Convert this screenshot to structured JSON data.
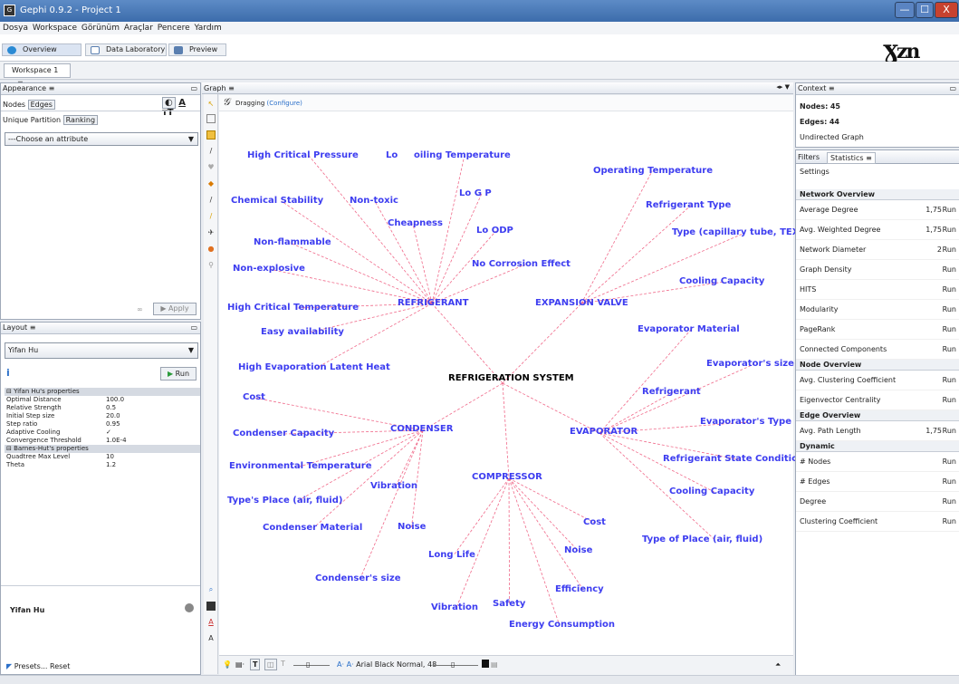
{
  "window": {
    "title": "Gephi 0.9.2 - Project 1",
    "minimize": "—",
    "maximize": "☐",
    "close": "X"
  },
  "menu": [
    "Dosya",
    "Workspace",
    "Görünüm",
    "Araçlar",
    "Pencere",
    "Yardım"
  ],
  "modes": {
    "overview": "Overview",
    "data_lab": "Data Laboratory",
    "preview": "Preview"
  },
  "workspace_tab": "Workspace 1",
  "tab_close": "≡",
  "appearance": {
    "title": "Appearance",
    "tabs": [
      "Nodes",
      "Edges"
    ],
    "subtabs": [
      "Unique",
      "Partition",
      "Ranking"
    ],
    "attribute_placeholder": "---Choose an attribute",
    "apply": "Apply",
    "icons": [
      "color-icon",
      "A",
      "тT"
    ]
  },
  "layout": {
    "title": "Layout",
    "algorithm": "Yifan Hu",
    "run": "Run",
    "footer_name": "Yifan Hu",
    "presets": "Presets...",
    "reset": "Reset",
    "props": [
      {
        "k": "Yifan Hu's properties",
        "v": "",
        "sec": true
      },
      {
        "k": "Optimal Distance",
        "v": "100.0"
      },
      {
        "k": "Relative Strength",
        "v": "0.5"
      },
      {
        "k": "Initial Step size",
        "v": "20.0"
      },
      {
        "k": "Step ratio",
        "v": "0.95"
      },
      {
        "k": "Adaptive Cooling",
        "v": "✓"
      },
      {
        "k": "Convergence Threshold",
        "v": "1.0E-4"
      },
      {
        "k": "Barnes-Hut's properties",
        "v": "",
        "sec": true
      },
      {
        "k": "Quadtree Max Level",
        "v": "10"
      },
      {
        "k": "Theta",
        "v": "1.2"
      }
    ]
  },
  "graph": {
    "title": "Graph",
    "mode": "Dragging",
    "configure": "(Configure)",
    "font_label": "Arial Black Normal, 48"
  },
  "context": {
    "title": "Context",
    "nodes_label": "Nodes:",
    "nodes": "45",
    "edges_label": "Edges:",
    "edges": "44",
    "graph_type": "Undirected Graph"
  },
  "stats_tabs": {
    "filters": "Filters",
    "statistics": "Statistics",
    "settings": "Settings"
  },
  "statistics": [
    {
      "label": "Network Overview",
      "sec": true
    },
    {
      "label": "Average Degree",
      "val": "1,75",
      "run": "Run"
    },
    {
      "label": "Avg. Weighted Degree",
      "val": "1,75",
      "run": "Run"
    },
    {
      "label": "Network Diameter",
      "val": "2",
      "run": "Run"
    },
    {
      "label": "Graph Density",
      "val": "",
      "run": "Run"
    },
    {
      "label": "HITS",
      "val": "",
      "run": "Run"
    },
    {
      "label": "Modularity",
      "val": "",
      "run": "Run"
    },
    {
      "label": "PageRank",
      "val": "",
      "run": "Run"
    },
    {
      "label": "Connected Components",
      "val": "",
      "run": "Run"
    },
    {
      "label": "Node Overview",
      "sec": true
    },
    {
      "label": "Avg. Clustering Coefficient",
      "val": "",
      "run": "Run"
    },
    {
      "label": "Eigenvector Centrality",
      "val": "",
      "run": "Run"
    },
    {
      "label": "Edge Overview",
      "sec": true
    },
    {
      "label": "Avg. Path Length",
      "val": "1,75",
      "run": "Run"
    },
    {
      "label": "Dynamic",
      "sec": true
    },
    {
      "label": "# Nodes",
      "val": "",
      "run": "Run"
    },
    {
      "label": "# Edges",
      "val": "",
      "run": "Run"
    },
    {
      "label": "Degree",
      "val": "",
      "run": "Run"
    },
    {
      "label": "Clustering Coefficient",
      "val": "",
      "run": "Run"
    }
  ],
  "nodes": [
    {
      "id": "RS",
      "label": "REFRIGERATION SYSTEM",
      "main": true
    },
    {
      "id": "REF",
      "label": "REFRIGERANT"
    },
    {
      "id": "EXP",
      "label": "EXPANSION VALVE"
    },
    {
      "id": "CON",
      "label": "CONDENSER"
    },
    {
      "id": "COM",
      "label": "COMPRESSOR"
    },
    {
      "id": "EVA",
      "label": "EVAPORATOR"
    },
    {
      "id": "r1",
      "label": "High Critical Pressure"
    },
    {
      "id": "r2",
      "label": "Lo"
    },
    {
      "id": "r3",
      "label": "oiling Temperature"
    },
    {
      "id": "r4",
      "label": "Chemical Stability"
    },
    {
      "id": "r5",
      "label": "Non-toxic"
    },
    {
      "id": "r6",
      "label": "Lo  G  P"
    },
    {
      "id": "r7",
      "label": "Cheapness"
    },
    {
      "id": "r8",
      "label": "Lo  ODP"
    },
    {
      "id": "r9",
      "label": "Non-flammable"
    },
    {
      "id": "r10",
      "label": "No Corrosion Effect"
    },
    {
      "id": "r11",
      "label": "Non-explosive"
    },
    {
      "id": "r12",
      "label": "High Critical Temperature"
    },
    {
      "id": "r13",
      "label": "Easy availability"
    },
    {
      "id": "r14",
      "label": "High Evaporation Latent Heat"
    },
    {
      "id": "x1",
      "label": "Operating Temperature"
    },
    {
      "id": "x2",
      "label": "Refrigerant Type"
    },
    {
      "id": "x3",
      "label": "Type (capillary tube, TEX)"
    },
    {
      "id": "x4",
      "label": "Cooling Capacity"
    },
    {
      "id": "e1",
      "label": "Evaporator Material"
    },
    {
      "id": "e2",
      "label": "Evaporator's size"
    },
    {
      "id": "e3",
      "label": "Refrigerant"
    },
    {
      "id": "e4",
      "label": "Evaporator's Type"
    },
    {
      "id": "e5",
      "label": "Refrigerant State Condition"
    },
    {
      "id": "e6",
      "label": "Cooling Capacity"
    },
    {
      "id": "e7",
      "label": "Type of Place (air, fluid)"
    },
    {
      "id": "c1",
      "label": "Cost"
    },
    {
      "id": "c2",
      "label": "Condenser Capacity"
    },
    {
      "id": "c3",
      "label": "Environmental Temperature"
    },
    {
      "id": "c4",
      "label": "Vibration"
    },
    {
      "id": "c5",
      "label": "Type's Place (air, fluid)"
    },
    {
      "id": "c6",
      "label": "Condenser Material"
    },
    {
      "id": "c7",
      "label": "Noise"
    },
    {
      "id": "c8",
      "label": "Condenser's size"
    },
    {
      "id": "p1",
      "label": "Cost"
    },
    {
      "id": "p2",
      "label": "Noise"
    },
    {
      "id": "p3",
      "label": "Long Life"
    },
    {
      "id": "p4",
      "label": "Efficiency"
    },
    {
      "id": "p5",
      "label": "Vibration"
    },
    {
      "id": "p6",
      "label": "Safety"
    },
    {
      "id": "p7",
      "label": "Energy Consumption"
    }
  ],
  "edge_color": "#f06a8a",
  "label_color": "#3d3df0"
}
